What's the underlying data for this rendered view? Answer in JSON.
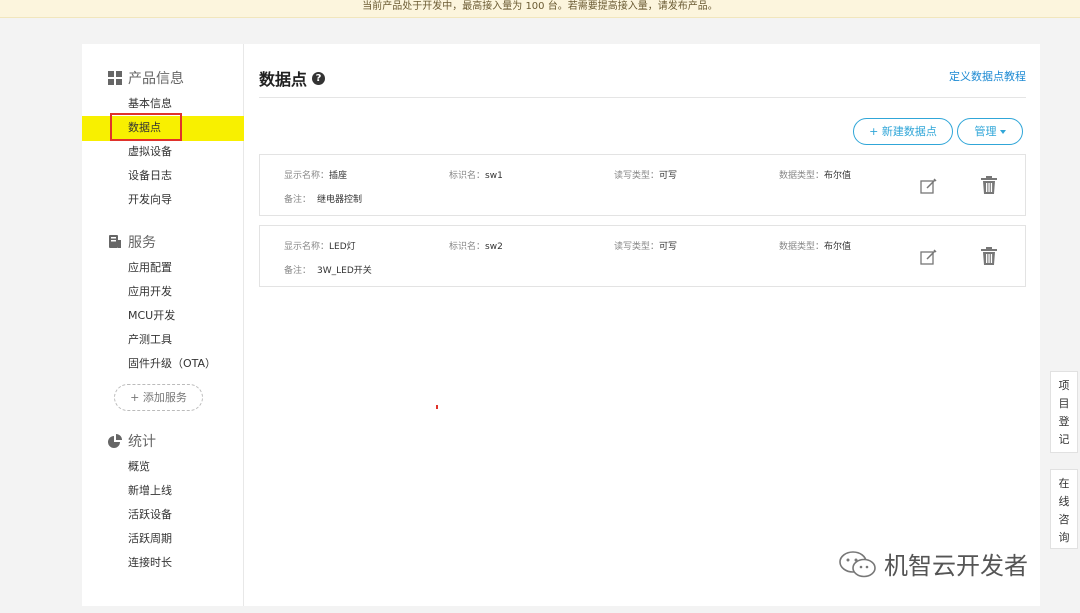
{
  "banner": {
    "text": "当前产品处于开发中，最高接入量为 100 台。若需要提高接入量，请发布产品。"
  },
  "sidebar": {
    "sections": [
      {
        "title": "产品信息",
        "icon": "grid-icon",
        "items": [
          "基本信息",
          "数据点",
          "虚拟设备",
          "设备日志",
          "开发向导"
        ]
      },
      {
        "title": "服务",
        "icon": "service-icon",
        "items": [
          "应用配置",
          "应用开发",
          "MCU开发",
          "产测工具",
          "固件升级（OTA）"
        ]
      },
      {
        "title": "统计",
        "icon": "pie-chart-icon",
        "items": [
          "概览",
          "新增上线",
          "活跃设备",
          "活跃周期",
          "连接时长"
        ]
      }
    ],
    "active_item": "数据点",
    "add_service_label": "+ 添加服务"
  },
  "main": {
    "title": "数据点",
    "tutorial_link": "定义数据点教程",
    "new_button": "+ 新建数据点",
    "manage_button": "管理",
    "datapoints": [
      {
        "display_label": "显示名称：",
        "display": "插座",
        "id_label": "标识名：",
        "id": "sw1",
        "rw_label": "读写类型：",
        "rw": "可写",
        "type_label": "数据类型：",
        "type": "布尔值",
        "note_label": "备注：",
        "note": "继电器控制"
      },
      {
        "display_label": "显示名称：",
        "display": "LED灯",
        "id_label": "标识名：",
        "id": "sw2",
        "rw_label": "读写类型：",
        "rw": "可写",
        "type_label": "数据类型：",
        "type": "布尔值",
        "note_label": "备注：",
        "note": "3W_LED开关"
      }
    ]
  },
  "side_tabs": {
    "project": [
      "项",
      "目",
      "登",
      "记"
    ],
    "consult": [
      "在",
      "线",
      "咨",
      "询"
    ]
  },
  "watermark": {
    "text": "机智云开发者",
    "icon": "wechat-icon"
  }
}
